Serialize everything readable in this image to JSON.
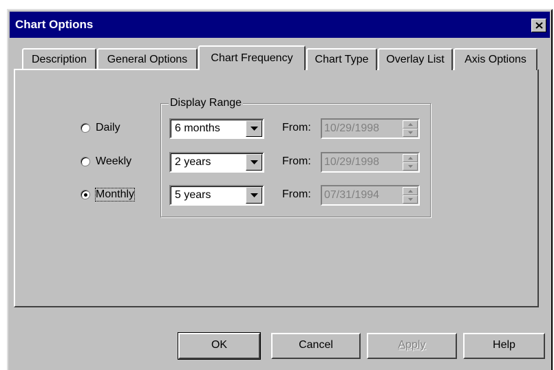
{
  "window": {
    "title": "Chart Options"
  },
  "tabs": [
    {
      "label": "Description"
    },
    {
      "label": "General Options"
    },
    {
      "label": "Chart Frequency"
    },
    {
      "label": "Chart Type"
    },
    {
      "label": "Overlay List"
    },
    {
      "label": "Axis Options"
    }
  ],
  "active_tab": "Chart Frequency",
  "frequency": {
    "options": [
      {
        "label": "Daily",
        "selected": false
      },
      {
        "label": "Weekly",
        "selected": false
      },
      {
        "label": "Monthly",
        "selected": true
      }
    ]
  },
  "display_range": {
    "label": "Display Range",
    "rows": [
      {
        "range": "6 months",
        "from_label": "From:",
        "from_date": "10/29/1998"
      },
      {
        "range": "2 years",
        "from_label": "From:",
        "from_date": "10/29/1998"
      },
      {
        "range": "5 years",
        "from_label": "From:",
        "from_date": "07/31/1994"
      }
    ]
  },
  "buttons": {
    "ok": "OK",
    "cancel": "Cancel",
    "apply": "Apply",
    "help": "Help"
  },
  "colors": {
    "titlebar": "#000080",
    "face": "#c0c0c0",
    "disabled_text": "#808080"
  }
}
